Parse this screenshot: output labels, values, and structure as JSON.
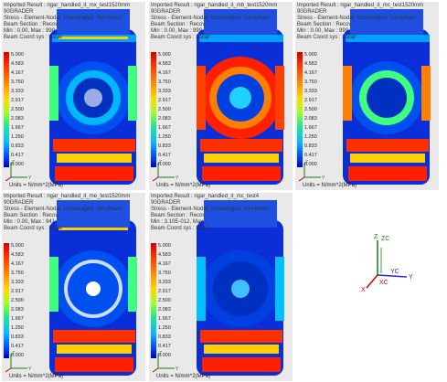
{
  "legend_values": [
    "5.000",
    "4.583",
    "4.167",
    "3.750",
    "3.333",
    "2.917",
    "2.500",
    "2.083",
    "1.667",
    "1.250",
    "0.833",
    "0.417",
    "0.000"
  ],
  "units": "Units = N/mm^2(MPa)",
  "panels": [
    {
      "l1": "Imported Result : rigar_handled_it_mx_test1520mm",
      "l2": "90GRADER",
      "l3": "Stress - Element-Nodal, Unaveraged, Von-Mises",
      "l4": "Beam Section : Recov",
      "l5": "Min : 0.00, Max : 990",
      "l6": "Beam Coord sys : Local"
    },
    {
      "l1": "Imported Result : rigar_handled_it_mb_test1520mm",
      "l2": "90GRADER",
      "l3": "Stress - Element-Nodal, Unaveraged, Von-Mises",
      "l4": "Beam Section : Recov",
      "l5": "Min : 0.00, Max : 999",
      "l6": "Beam Coord sys : Local"
    },
    {
      "l1": "Imported Result : rigar_handled_it_mc_test1520mm",
      "l2": "90GRADER",
      "l3": "Stress - Element-Nodal, Unaveraged, Von-Mises",
      "l4": "Beam Section : Recov",
      "l5": "Min : 0.00, Max : 999",
      "l6": "Beam Coord sys : Local"
    },
    {
      "l1": "Imported Result : rigar_handled_it_me_test1520mm",
      "l2": "90GRADER",
      "l3": "Stress - Element-Nodal, Unaveraged, Von-Mises",
      "l4": "Beam Section : Recov",
      "l5": "Min : 0.00, Max : 941",
      "l6": "Beam Coord sys : Local"
    },
    {
      "l1": "Imported Result : rigar_handled_it_mc_test4",
      "l2": "90GRADER",
      "l3": "Stress - Element-Nodal, Unaveraged, Von-Mises",
      "l4": "Beam Section : Recov",
      "l5": "Min : 3.10E-012, Max :",
      "l6": "Beam Coord sys : Local"
    }
  ],
  "triad": {
    "z": "Z",
    "y": "Y",
    "x": "X"
  },
  "big_triad": {
    "zc": "ZC",
    "z": "Z",
    "yc": "YC",
    "y": "Y",
    "xc": "XC",
    "x": "X"
  }
}
